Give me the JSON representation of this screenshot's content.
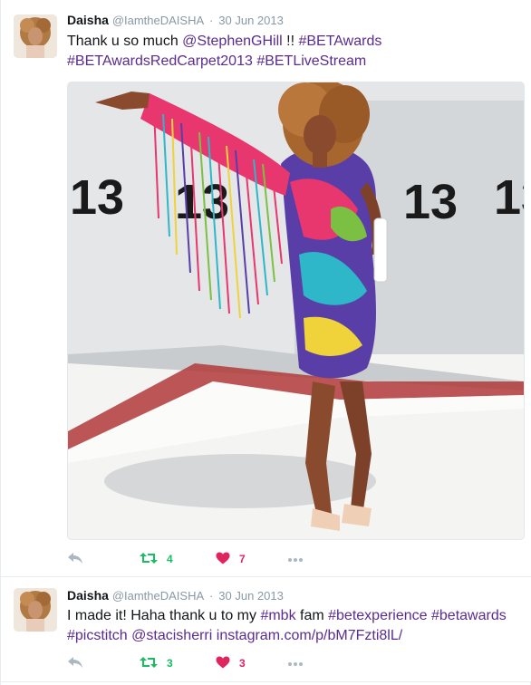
{
  "tweets": [
    {
      "fullname": "Daisha",
      "username": "@IamtheDAISHA",
      "separator": "·",
      "date": "30 Jun 2013",
      "text_segments": [
        {
          "text": "Thank u so much ",
          "link": false
        },
        {
          "text": "@StephenGHill",
          "link": true
        },
        {
          "text": " !! ",
          "link": false
        },
        {
          "text": "#BETAwards",
          "link": true
        },
        {
          "text": " ",
          "link": false
        },
        {
          "text": "#BETAwardsRedCarpet2013",
          "link": true
        },
        {
          "text": " ",
          "link": false
        },
        {
          "text": "#BETLiveStream",
          "link": true
        }
      ],
      "has_media": true,
      "retweets": "4",
      "likes": "7"
    },
    {
      "fullname": "Daisha",
      "username": "@IamtheDAISHA",
      "separator": "·",
      "date": "30 Jun 2013",
      "text_segments": [
        {
          "text": "I made it! Haha thank u to my ",
          "link": false
        },
        {
          "text": "#mbk",
          "link": true
        },
        {
          "text": " fam ",
          "link": false
        },
        {
          "text": "#betexperience",
          "link": true
        },
        {
          "text": " ",
          "link": false
        },
        {
          "text": "#betawards",
          "link": true
        },
        {
          "text": " ",
          "link": false
        },
        {
          "text": "#picstitch",
          "link": true
        },
        {
          "text": " ",
          "link": false
        },
        {
          "text": "@stacisherri",
          "link": true
        },
        {
          "text": " ",
          "link": false
        },
        {
          "text": "instagram.com/p/bM7Fzti8lL/",
          "link": true
        }
      ],
      "has_media": false,
      "retweets": "3",
      "likes": "3"
    }
  ],
  "colors": {
    "link": "#5b2c8f",
    "retweet": "#17bf63",
    "like": "#e0245e",
    "muted": "#8899a6"
  },
  "icons": {
    "reply": "reply-icon",
    "retweet": "retweet-icon",
    "like": "heart-icon",
    "more": "more-icon"
  }
}
